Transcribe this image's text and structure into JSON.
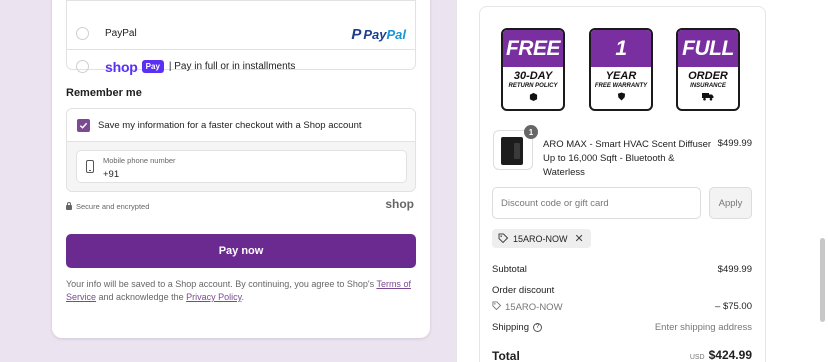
{
  "payment": {
    "paypal_label": "PayPal",
    "paypal_logo_p": "P",
    "paypal_logo_pay": "Pay",
    "paypal_logo_pal": "Pal",
    "shop_logo": "shop",
    "shop_badge": "Pay",
    "shop_label": "| Pay in full or in installments"
  },
  "remember": {
    "title": "Remember me",
    "checkbox_label": "Save my information for a faster checkout with a Shop account",
    "phone_label": "Mobile phone number",
    "phone_value": "+91"
  },
  "secure": {
    "text": "Secure and encrypted",
    "shop_mark": "shop"
  },
  "pay_now_label": "Pay now",
  "info": {
    "prefix": "Your info will be saved to a Shop account. By continuing, you agree to Shop's ",
    "terms_link": "Terms of Service",
    "middle": " and acknowledge the ",
    "privacy_link": "Privacy Policy",
    "suffix": "."
  },
  "badges": [
    {
      "head": "FREE",
      "mid": "30-DAY",
      "sub": "RETURN POLICY",
      "icon": "box-icon"
    },
    {
      "head": "1",
      "mid": "YEAR",
      "sub": "FREE WARRANTY",
      "icon": "shield-icon"
    },
    {
      "head": "FULL",
      "mid": "ORDER",
      "sub": "INSURANCE",
      "icon": "truck-icon"
    }
  ],
  "product": {
    "quantity": "1",
    "name": "ARO MAX - Smart HVAC Scent Diffuser Up to 16,000 Sqft - Bluetooth & Waterless",
    "price": "$499.99"
  },
  "discount": {
    "placeholder": "Discount code or gift card",
    "apply_label": "Apply",
    "applied_code": "15ARO-NOW"
  },
  "summary": {
    "subtotal_label": "Subtotal",
    "subtotal_value": "$499.99",
    "order_discount_label": "Order discount",
    "discount_code": "15ARO-NOW",
    "discount_value": "– $75.00",
    "shipping_label": "Shipping",
    "shipping_value": "Enter shipping address",
    "total_label": "Total",
    "currency": "USD",
    "total_value": "$424.99"
  }
}
